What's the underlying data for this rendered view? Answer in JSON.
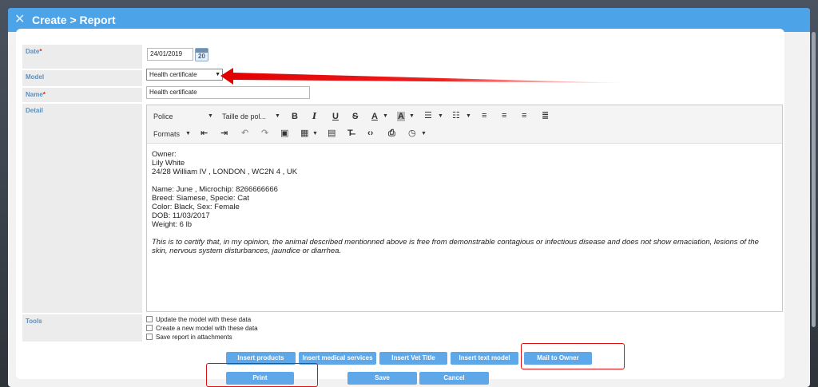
{
  "window": {
    "title": "Create > Report",
    "close_icon": "close-icon"
  },
  "form": {
    "date": {
      "label": "Date",
      "required_mark": "*",
      "value": "24/01/2019",
      "calendar_day": "20"
    },
    "model": {
      "label": "Model",
      "selected": "Health certificate"
    },
    "name": {
      "label": "Name",
      "required_mark": "*",
      "value": "Health certificate"
    },
    "detail": {
      "label": "Detail"
    },
    "tools": {
      "label": "Tools",
      "options": [
        "Update the model with these data",
        "Create a new model with these data",
        "Save report in attachments"
      ]
    }
  },
  "toolbar": {
    "font_family": "Police",
    "font_size": "Taille de pol...",
    "formats": "Formats"
  },
  "document": {
    "lines": [
      "Owner:",
      "Lily White",
      "24/28 William IV  , LONDON , WC2N 4  , UK",
      "",
      "Name: June , Microchip: 8266666666",
      "Breed: Siamese, Specie: Cat",
      "Color: Black, Sex: Female",
      "DOB: 11/03/2017",
      "Weight: 6 lb"
    ],
    "certification": "This is to certify that, in my opinion, the animal described mentionned above is free from demonstrable contagious or infectious disease and does not show emaciation, lesions of the skin, nervous system disturbances, jaundice or diarrhea."
  },
  "buttons": {
    "insert_products": "Insert products",
    "insert_medical_services": "Insert medical services",
    "insert_vet_title": "Insert Vet Title",
    "insert_text_model": "Insert text model",
    "mail_to_owner": "Mail to Owner",
    "print": "Print",
    "save": "Save",
    "cancel": "Cancel"
  },
  "colors": {
    "titlebar": "#4da3e8",
    "button": "#5ea8ea",
    "highlight": "#dd1111",
    "label": "#5a8fc0"
  }
}
